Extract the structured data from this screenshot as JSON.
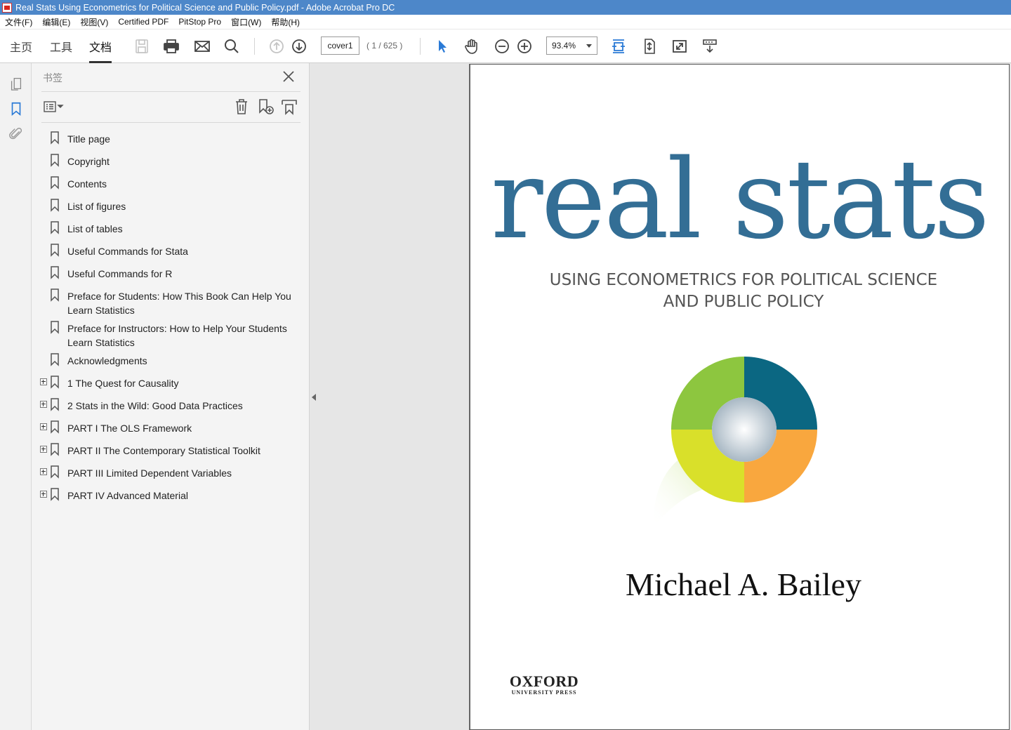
{
  "window": {
    "title": "Real Stats Using Econometrics for Political Science and Public Policy.pdf - Adobe Acrobat Pro DC"
  },
  "menu": [
    "文件(F)",
    "编辑(E)",
    "视图(V)",
    "Certified PDF",
    "PitStop Pro",
    "窗口(W)",
    "帮助(H)"
  ],
  "toolbar": {
    "tabs": [
      "主页",
      "工具",
      "文档"
    ],
    "active_tab": "文档",
    "page_value": "cover1",
    "page_count": "( 1 / 625 )",
    "zoom_value": "93.4%"
  },
  "panel": {
    "title": "书签",
    "bookmarks": [
      {
        "label": "Title page",
        "expandable": false
      },
      {
        "label": "Copyright",
        "expandable": false
      },
      {
        "label": "Contents",
        "expandable": false
      },
      {
        "label": "List of figures",
        "expandable": false
      },
      {
        "label": "List of tables",
        "expandable": false
      },
      {
        "label": "Useful Commands for Stata",
        "expandable": false
      },
      {
        "label": "Useful Commands for R",
        "expandable": false
      },
      {
        "label": "Preface for Students: How This Book Can Help You Learn Statistics",
        "expandable": false
      },
      {
        "label": "Preface for Instructors: How to Help Your Students Learn Statistics",
        "expandable": false
      },
      {
        "label": "Acknowledgments",
        "expandable": false
      },
      {
        "label": "1 The Quest for Causality",
        "expandable": true
      },
      {
        "label": "2 Stats in the Wild: Good Data Practices",
        "expandable": true
      },
      {
        "label": "PART I The OLS Framework",
        "expandable": true
      },
      {
        "label": "PART II The Contemporary Statistical Toolkit",
        "expandable": true
      },
      {
        "label": "PART III Limited Dependent Variables",
        "expandable": true
      },
      {
        "label": "PART IV Advanced Material",
        "expandable": true
      }
    ]
  },
  "cover": {
    "title": "real stats",
    "subtitle_line1": "Using Econometrics for Political Science",
    "subtitle_line2": "and Public Policy",
    "author": "Michael A. Bailey",
    "publisher": "OXFORD",
    "publisher_sub": "UNIVERSITY PRESS"
  },
  "colors": {
    "titlebar": "#4d87c9",
    "title_blue": "#336e95",
    "logo_green": "#8dc63f",
    "logo_teal": "#0b6782",
    "logo_yellow": "#d9e02a",
    "logo_orange": "#f9a73e",
    "selection_blue": "#2a7ad6"
  }
}
